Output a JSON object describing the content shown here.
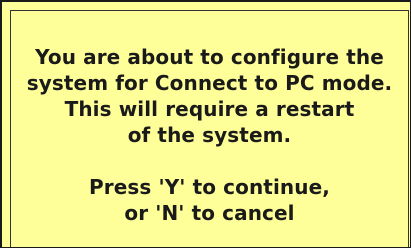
{
  "dialog": {
    "background_color": "#ffff99",
    "text_color": "#1a1a1a",
    "message_lines": [
      "You are about to configure the",
      "system for Connect to PC mode.",
      "This will require a restart",
      "of the system."
    ],
    "prompt_lines": [
      "Press 'Y' to continue,",
      "or 'N' to cancel"
    ]
  }
}
